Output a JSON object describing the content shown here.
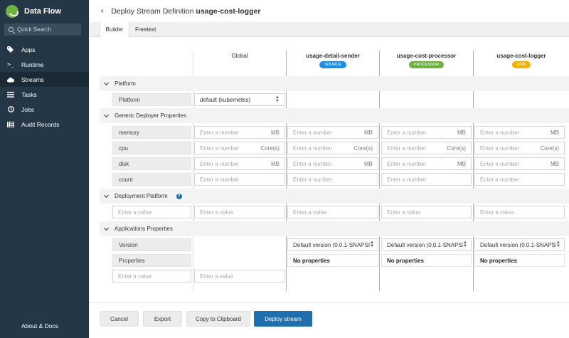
{
  "app": {
    "title": "Data Flow"
  },
  "search": {
    "placeholder": "Quick Search"
  },
  "nav": [
    {
      "label": "Apps",
      "icon": "tag-icon"
    },
    {
      "label": "Runtime",
      "icon": "terminal-icon"
    },
    {
      "label": "Streams",
      "icon": "cloud-icon",
      "active": true
    },
    {
      "label": "Tasks",
      "icon": "list-icon"
    },
    {
      "label": "Jobs",
      "icon": "clock-icon"
    },
    {
      "label": "Audit Records",
      "icon": "table-icon"
    }
  ],
  "about": "About & Docs",
  "header": {
    "prefix": "Deploy Stream Definition",
    "stream_name": "usage-cost-logger"
  },
  "tabs": [
    "Builder",
    "Freetext"
  ],
  "columns": {
    "global": "Global",
    "apps": [
      {
        "name": "usage-detail-sender",
        "badge": "SOURCE",
        "color": "#1e90e5"
      },
      {
        "name": "usage-cost-processor",
        "badge": "PROCESSOR",
        "color": "#6db33f"
      },
      {
        "name": "usage-cost-logger",
        "badge": "SINK",
        "color": "#f0b400"
      }
    ]
  },
  "sections": {
    "platform": "Platform",
    "deployer": "Generic Deployer Properties",
    "deployment_platform": "Deployment Platform",
    "applications": "Applications Properties"
  },
  "rows": {
    "platform_label": "Platform",
    "platform_value": "default (kubernetes)",
    "memory": "memory",
    "cpu": "cpu",
    "disk": "disk",
    "count": "count",
    "version": "Version",
    "properties": "Properties"
  },
  "placeholders": {
    "number": "Enter a number",
    "value": "Enter a value"
  },
  "units": {
    "mb": "MB",
    "cores": "Core(s)"
  },
  "version_value": "Default version (0.0.1-SNAPSI",
  "no_properties": "No properties",
  "buttons": {
    "cancel": "Cancel",
    "export": "Export",
    "copy": "Copy to Clipboard",
    "deploy": "Deploy stream"
  }
}
